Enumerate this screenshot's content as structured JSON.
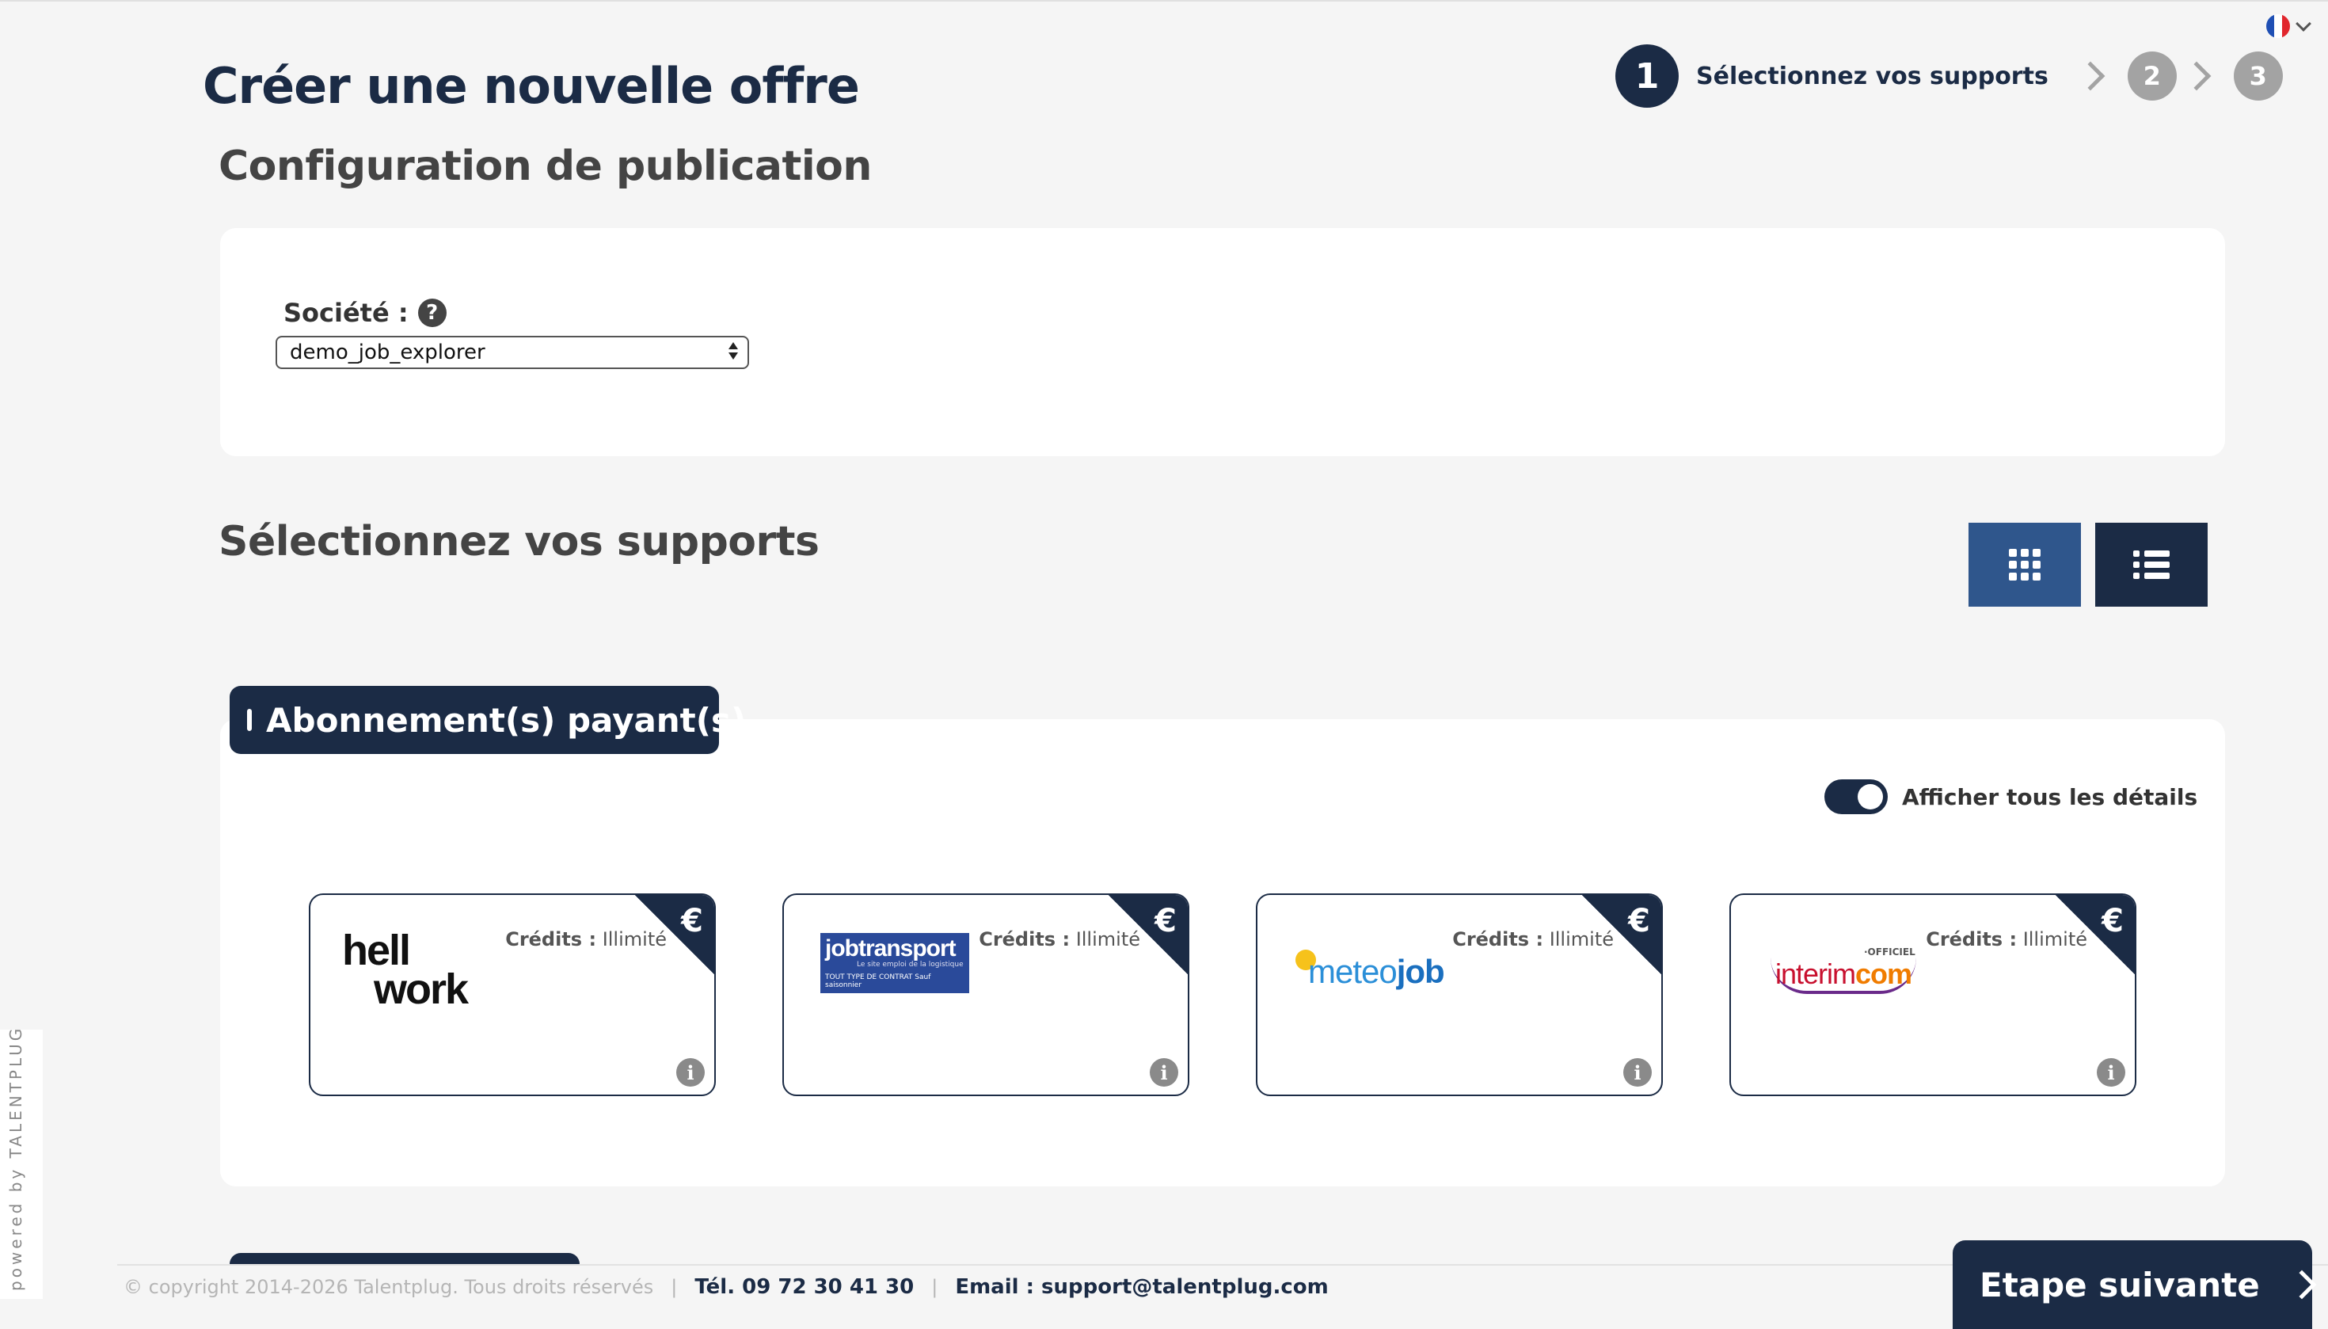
{
  "header": {
    "title": "Créer une nouvelle offre",
    "language_flag_colors": [
      "#1f4fb4",
      "#ffffff",
      "#e1262d"
    ],
    "steps": [
      {
        "number": "1",
        "label": "Sélectionnez vos supports",
        "active": true
      },
      {
        "number": "2"
      },
      {
        "number": "3"
      }
    ]
  },
  "config": {
    "title": "Configuration de publication",
    "societe_label": "Société :",
    "help_icon": "?",
    "societe_value": "demo_job_explorer"
  },
  "supports": {
    "title": "Sélectionnez vos supports",
    "view_grid": "grid-icon",
    "view_list": "list-icon"
  },
  "subscriptions": {
    "tab_label": "Abonnement(s) payant(s)",
    "toggle_label": "Afficher tous les détails",
    "toggle_on": true,
    "cards": [
      {
        "logo": "hellowork",
        "credits_label": "Crédits :",
        "credits_value": "Illimité",
        "badge": "€",
        "info": "i"
      },
      {
        "logo": "jobtransport",
        "credits_label": "Crédits :",
        "credits_value": "Illimité",
        "badge": "€",
        "info": "i"
      },
      {
        "logo": "meteojob",
        "credits_label": "Crédits :",
        "credits_value": "Illimité",
        "badge": "€",
        "info": "i"
      },
      {
        "logo": "interimcom",
        "credits_label": "Crédits :",
        "credits_value": "Illimité",
        "badge": "€",
        "info": "i"
      }
    ]
  },
  "logos": {
    "hellowork_line1": "hell",
    "hellowork_line2": "work",
    "jobtransport_main": "jobtransport",
    "jobtransport_sub": "Le site emploi de la logistique",
    "jobtransport_tag": "TOUT TYPE DE CONTRAT Sauf saisonnier",
    "meteojob_a": "meteo",
    "meteojob_b": "job",
    "interim_small": "·OFFICIEL",
    "interim_a": "interim",
    "interim_b": "com"
  },
  "sidebar": {
    "powered_by": "powered by TALENTPLUG"
  },
  "footer": {
    "copyright": "© copyright 2014-2026 Talentplug. Tous droits réservés",
    "separator": "|",
    "tel": "Tél. 09 72 30 41 30",
    "email": "Email : support@talentplug.com",
    "next_button": "Etape suivante"
  },
  "colors": {
    "navy": "#1b2b45",
    "grid_button": "#2f568c",
    "step_inactive": "#a3a3a3",
    "background": "#f5f5f5"
  }
}
